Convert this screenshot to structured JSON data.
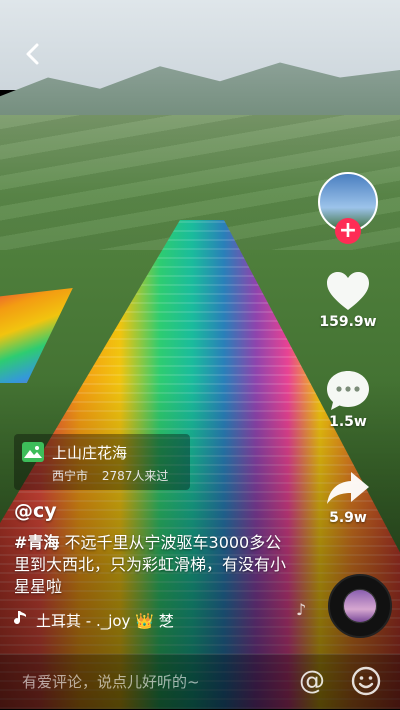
{
  "video": {
    "description_elements": [
      "sky",
      "mountains",
      "fields",
      "rainbow-slide"
    ]
  },
  "nav": {
    "back_icon": "chevron-left-icon"
  },
  "sidebar": {
    "follow_label": "+",
    "like": {
      "icon": "heart-icon",
      "count": "159.9w"
    },
    "comment": {
      "icon": "speech-bubble-icon",
      "count": "1.5w"
    },
    "share": {
      "icon": "share-arrow-icon",
      "count": "5.9w"
    }
  },
  "poi": {
    "name": "上山庄花海",
    "city": "西宁市",
    "visitors": "2787人来过"
  },
  "post": {
    "handle": "@cy",
    "hashtag": "#青海",
    "caption": " 不远千里从宁波驱车3000多公里到大西北，只为彩虹滑梯，有没有小星星啦"
  },
  "music": {
    "title_part1": "土耳其 - ._joy",
    "crown": "👑",
    "tail": "椘"
  },
  "comment_bar": {
    "placeholder": "有爱评论，说点儿好听的~",
    "at_label": "@"
  },
  "colors": {
    "accent": "#fe2c55",
    "poi_badge": "#3dbd5a"
  }
}
